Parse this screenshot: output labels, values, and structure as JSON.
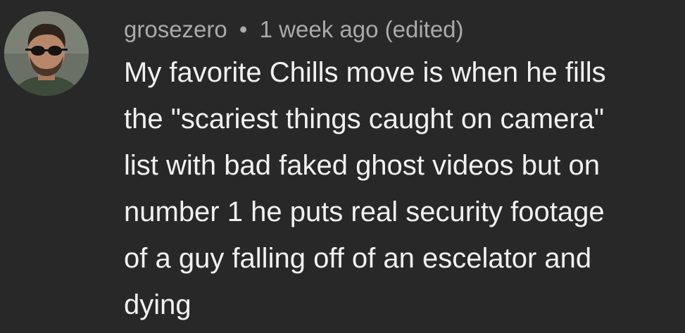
{
  "comment": {
    "author": "grosezero",
    "separator": "•",
    "timestamp": "1 week ago",
    "edited_label": "(edited)",
    "text_lines": [
      "My favorite Chills move is when he fills",
      "the \"scariest things caught on camera\"",
      "list with bad faked ghost videos but on",
      "number 1 he puts real security footage",
      "of a guy falling off of an escelator and",
      "dying"
    ]
  },
  "colors": {
    "background": "#282828",
    "meta_text": "#aaaaaa",
    "body_text": "#f1f1f1"
  },
  "icons": {
    "avatar": "user-avatar-man-with-sunglasses"
  }
}
